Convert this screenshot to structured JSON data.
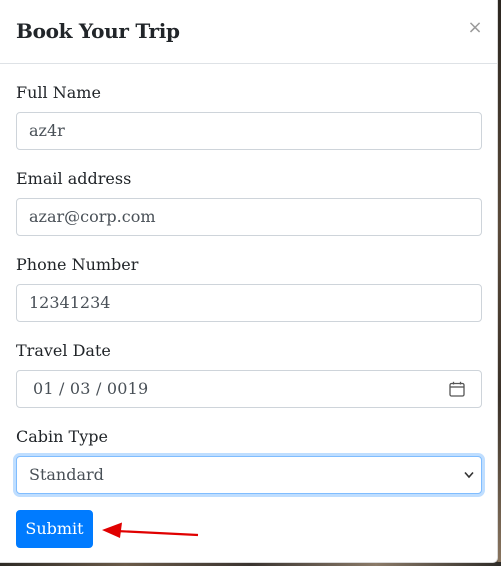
{
  "modal": {
    "title": "Book Your Trip",
    "close_glyph": "×"
  },
  "form": {
    "full_name": {
      "label": "Full Name",
      "value": "az4r"
    },
    "email": {
      "label": "Email address",
      "value": "azar@corp.com"
    },
    "phone": {
      "label": "Phone Number",
      "value": "12341234"
    },
    "travel_date": {
      "label": "Travel Date",
      "value": "01 / 03 / 0019"
    },
    "cabin_type": {
      "label": "Cabin Type",
      "selected": "Standard"
    },
    "submit_label": "Submit"
  },
  "icons": {
    "close": "close-icon",
    "calendar": "calendar-icon",
    "chevron": "chevron-down-icon",
    "annotation_arrow": "arrow-icon"
  },
  "colors": {
    "primary": "#007bff",
    "focus_border": "#80bdff",
    "annotation_red": "#e00000",
    "text": "#212529",
    "input_text": "#495057"
  }
}
